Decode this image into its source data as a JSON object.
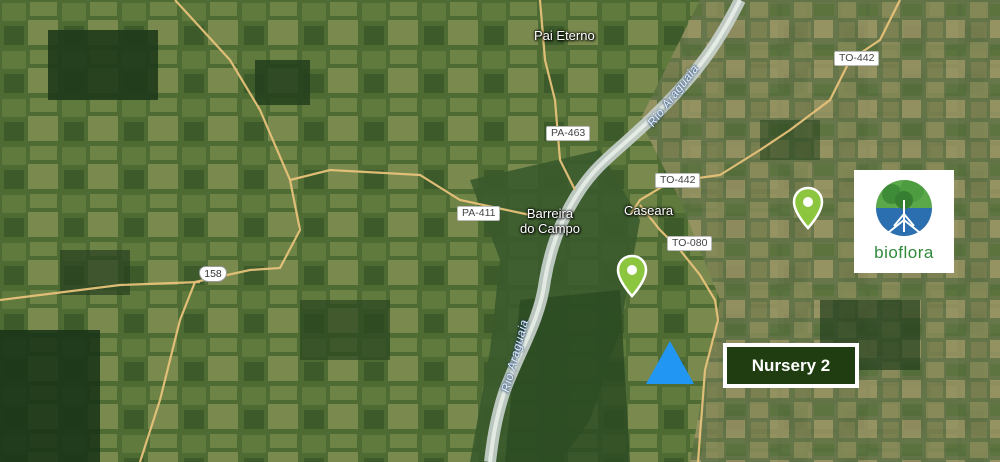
{
  "places": {
    "pai_eterno": "Pai Eterno",
    "barreira": "Barreira\ndo Campo",
    "caseara": "Caseara"
  },
  "roads": {
    "to442_ne": "TO-442",
    "to442": "TO-442",
    "pa463": "PA-463",
    "pa411": "PA-411",
    "to080": "TO-080",
    "br158": "158"
  },
  "rivers": {
    "north": "Rio Araguaia",
    "south": "Rio Araguaia"
  },
  "markers": {
    "pin_color": "#8cc63f",
    "triangle_color": "#2196f3",
    "nursery_label": "Nursery 2"
  },
  "logo": {
    "text": "bioflora"
  }
}
